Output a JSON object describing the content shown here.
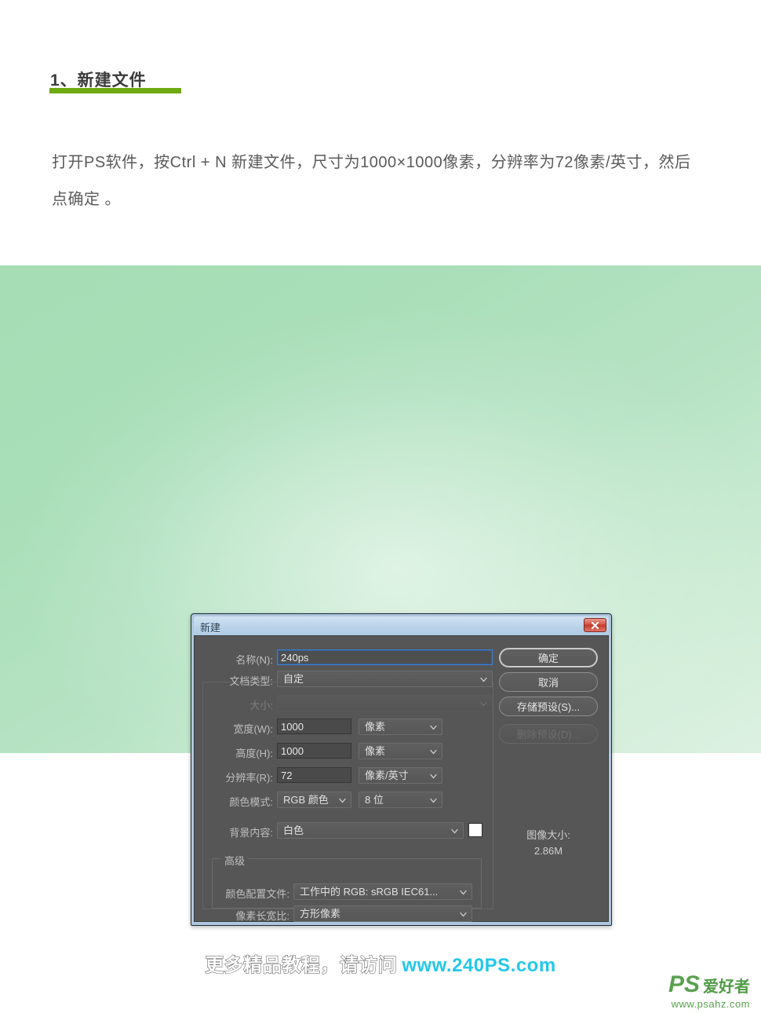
{
  "article": {
    "heading": "1、新建文件",
    "paragraph": "打开PS软件，按Ctrl + N 新建文件，尺寸为1000×1000像素，分辨率为72像素/英寸，然后点确定 。",
    "underline_color": "#6faa13",
    "text_color": "#5a5a5a"
  },
  "canvas": {
    "background_from": "#a6ddb4",
    "background_to": "#ddf1e2"
  },
  "dialog": {
    "title": "新建",
    "close_label": "x",
    "fields": {
      "name_label": "名称(N):",
      "name_value": "240ps",
      "doc_type_label": "文档类型:",
      "doc_type_value": "自定",
      "size_label": "大小:",
      "size_value": "",
      "width_label": "宽度(W):",
      "width_value": "1000",
      "width_unit": "像素",
      "height_label": "高度(H):",
      "height_value": "1000",
      "height_unit": "像素",
      "resolution_label": "分辨率(R):",
      "resolution_value": "72",
      "resolution_unit": "像素/英寸",
      "color_mode_label": "颜色模式:",
      "color_mode_value": "RGB 颜色",
      "bit_depth_value": "8 位",
      "background_label": "背景内容:",
      "background_value": "白色",
      "background_swatch": "#ffffff"
    },
    "advanced": {
      "legend": "高级",
      "profile_label": "颜色配置文件:",
      "profile_value": "工作中的 RGB: sRGB IEC61...",
      "aspect_label": "像素长宽比:",
      "aspect_value": "方形像素"
    },
    "buttons": {
      "ok": "确定",
      "cancel": "取消",
      "save_preset": "存储预设(S)...",
      "delete_preset": "删除预设(D)..."
    },
    "image_size": {
      "label": "图像大小:",
      "value": "2.86M"
    }
  },
  "watermark": {
    "text_cn": "更多精品教程，请访问",
    "url": "www.240PS.com",
    "url_color": "#23c8e8"
  },
  "logo": {
    "ps": "PS",
    "cn": "爱好者",
    "url": "www.psahz.com",
    "color": "#59a14f"
  }
}
